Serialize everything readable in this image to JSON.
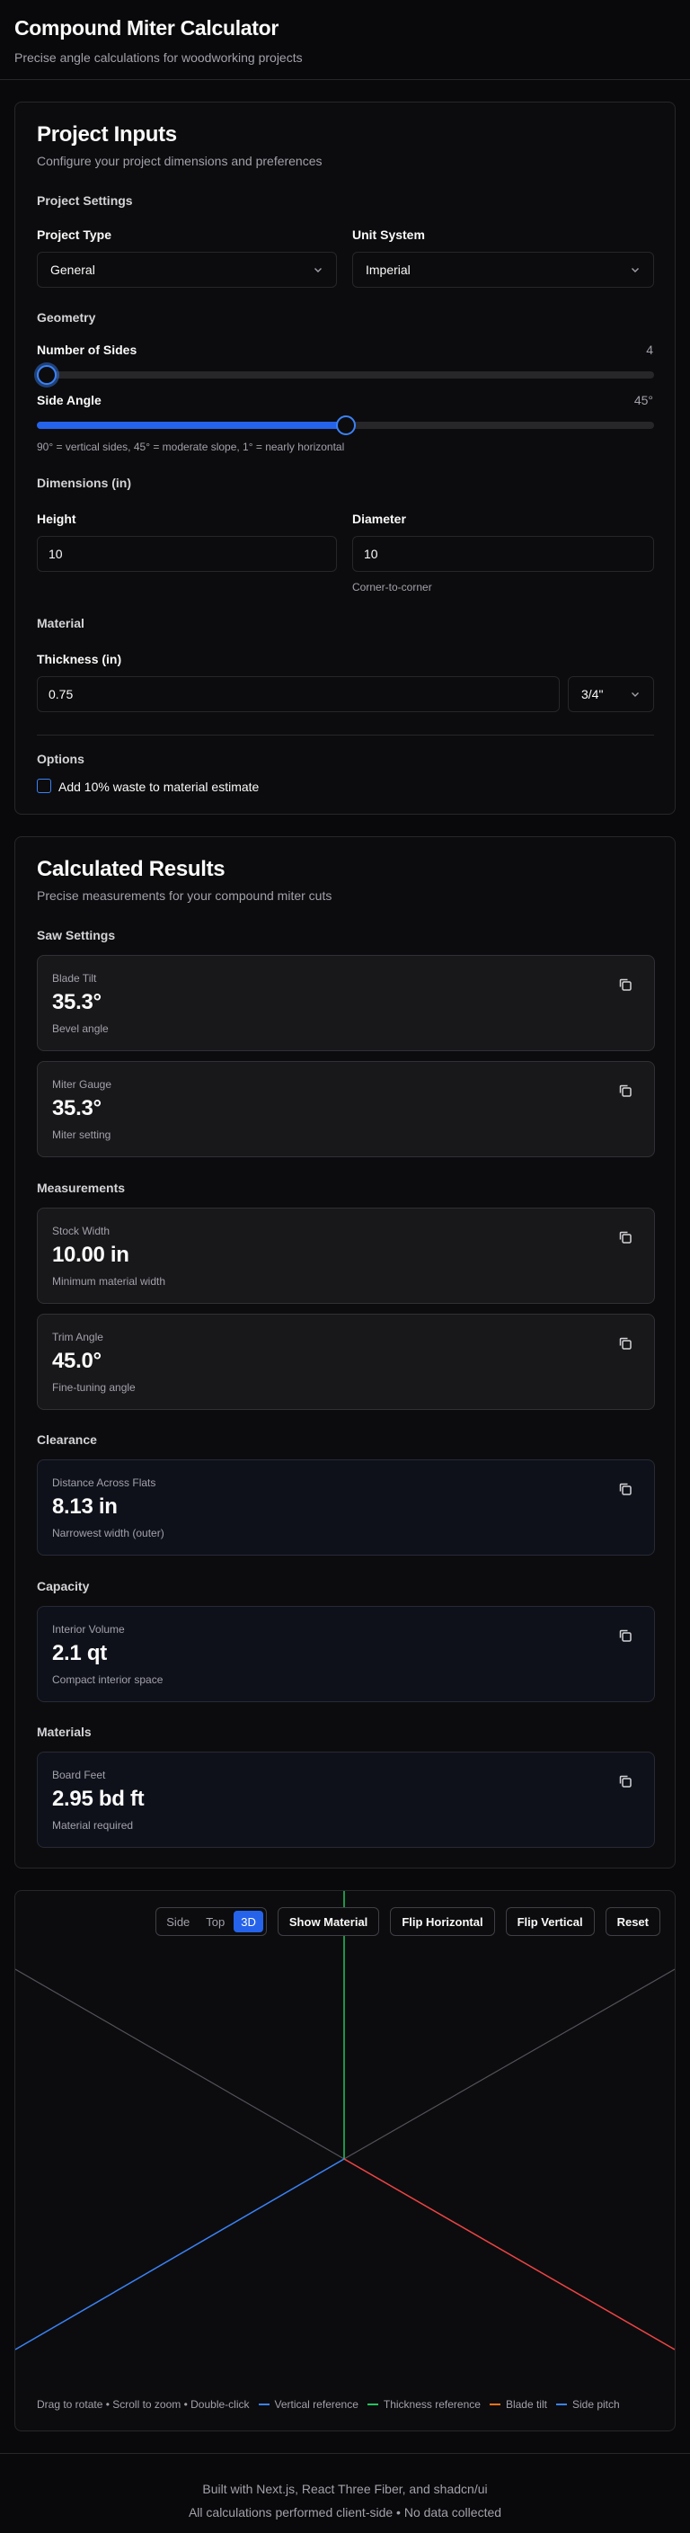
{
  "header": {
    "title": "Compound Miter Calculator",
    "subtitle": "Precise angle calculations for woodworking projects"
  },
  "inputs": {
    "title": "Project Inputs",
    "description": "Configure your project dimensions and preferences",
    "project_settings_label": "Project Settings",
    "project_type": {
      "label": "Project Type",
      "value": "General"
    },
    "unit_system": {
      "label": "Unit System",
      "value": "Imperial"
    },
    "geometry_label": "Geometry",
    "sides": {
      "label": "Number of Sides",
      "value": "4",
      "fraction": 0.0
    },
    "side_angle": {
      "label": "Side Angle",
      "value": "45°",
      "fraction": 0.5,
      "hint": "90° = vertical sides, 45° = moderate slope, 1° = nearly horizontal"
    },
    "dimensions_label": "Dimensions (in)",
    "height": {
      "label": "Height",
      "value": "10"
    },
    "diameter": {
      "label": "Diameter",
      "value": "10",
      "hint": "Corner-to-corner"
    },
    "material_label": "Material",
    "thickness": {
      "label": "Thickness (in)",
      "value": "0.75",
      "preset": "3/4\""
    },
    "options_label": "Options",
    "waste_option": {
      "label": "Add 10% waste to material estimate",
      "checked": false
    }
  },
  "results": {
    "title": "Calculated Results",
    "description": "Precise measurements for your compound miter cuts",
    "saw_settings_label": "Saw Settings",
    "blade_tilt": {
      "label": "Blade Tilt",
      "value": "35.3°",
      "sub": "Bevel angle"
    },
    "miter_gauge": {
      "label": "Miter Gauge",
      "value": "35.3°",
      "sub": "Miter setting"
    },
    "measurements_label": "Measurements",
    "stock_width": {
      "label": "Stock Width",
      "value": "10.00 in",
      "sub": "Minimum material width"
    },
    "trim_angle": {
      "label": "Trim Angle",
      "value": "45.0°",
      "sub": "Fine-tuning angle"
    },
    "clearance_label": "Clearance",
    "distance_flats": {
      "label": "Distance Across Flats",
      "value": "8.13 in",
      "sub": "Narrowest width (outer)"
    },
    "capacity_label": "Capacity",
    "interior_volume": {
      "label": "Interior Volume",
      "value": "2.1 qt",
      "sub": "Compact interior space"
    },
    "materials_label": "Materials",
    "board_feet": {
      "label": "Board Feet",
      "value": "2.95 bd ft",
      "sub": "Material required"
    }
  },
  "viewer": {
    "views": [
      "Side",
      "Top",
      "3D"
    ],
    "active_view": "3D",
    "show_material": "Show Material",
    "flip_horizontal": "Flip Horizontal",
    "flip_vertical": "Flip Vertical",
    "reset": "Reset",
    "help": "Drag to rotate • Scroll to zoom • Double-click",
    "legend": [
      {
        "label": "Vertical reference",
        "color": "#3b82f6"
      },
      {
        "label": "Thickness reference",
        "color": "#22c55e"
      },
      {
        "label": "Blade tilt",
        "color": "#f97316"
      },
      {
        "label": "Side pitch",
        "color": "#3b82f6"
      }
    ],
    "axis_colors": {
      "x": "#ef4444",
      "y": "#22c55e",
      "z": "#3b82f6",
      "grid": "#52525b"
    }
  },
  "footer": {
    "line1": "Built with Next.js, React Three Fiber, and shadcn/ui",
    "line2": "All calculations performed client-side • No data collected"
  },
  "colors": {
    "accent": "#2563eb",
    "background": "#09090b",
    "card": "#0c0c0e",
    "border": "#27272a"
  }
}
